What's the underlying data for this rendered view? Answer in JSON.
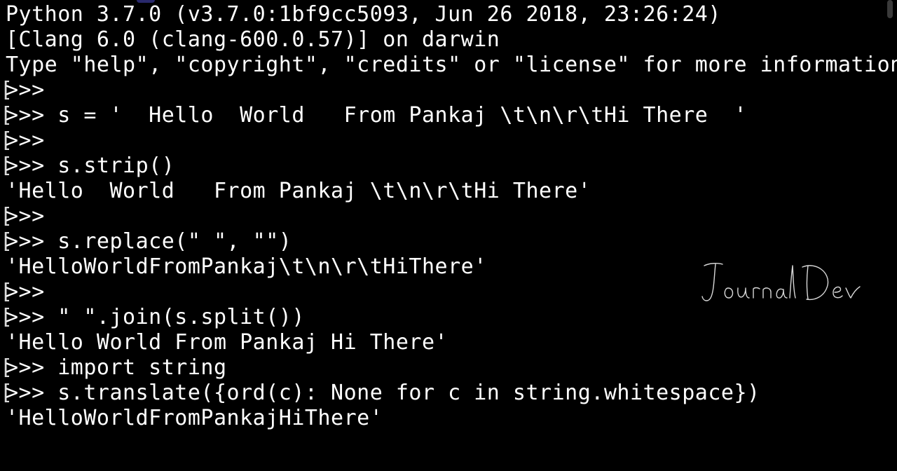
{
  "terminal": {
    "lines": [
      {
        "marker": false,
        "text": "Python 3.7.0 (v3.7.0:1bf9cc5093, Jun 26 2018, 23:26:24)"
      },
      {
        "marker": false,
        "text": "[Clang 6.0 (clang-600.0.57)] on darwin"
      },
      {
        "marker": false,
        "text": "Type \"help\", \"copyright\", \"credits\" or \"license\" for more information."
      },
      {
        "marker": true,
        "text": ">>>"
      },
      {
        "marker": true,
        "text": ">>> s = '  Hello  World   From Pankaj \\t\\n\\r\\tHi There  '"
      },
      {
        "marker": true,
        "text": ">>>"
      },
      {
        "marker": true,
        "text": ">>> s.strip()"
      },
      {
        "marker": false,
        "text": "'Hello  World   From Pankaj \\t\\n\\r\\tHi There'"
      },
      {
        "marker": true,
        "text": ">>>"
      },
      {
        "marker": true,
        "text": ">>> s.replace(\" \", \"\")"
      },
      {
        "marker": false,
        "text": "'HelloWorldFromPankaj\\t\\n\\r\\tHiThere'"
      },
      {
        "marker": true,
        "text": ">>>"
      },
      {
        "marker": true,
        "text": ">>> \" \".join(s.split())"
      },
      {
        "marker": false,
        "text": "'Hello World From Pankaj Hi There'"
      },
      {
        "marker": true,
        "text": ">>> import string"
      },
      {
        "marker": true,
        "text": ">>> s.translate({ord(c): None for c in string.whitespace})"
      },
      {
        "marker": false,
        "text": "'HelloWorldFromPankajHiThere'"
      }
    ],
    "marker_char": "[",
    "prompt": ">>>",
    "watermark": "JournalDev",
    "colors": {
      "background": "#000000",
      "foreground": "#ffffff",
      "cursor": "#a9a9a9"
    }
  }
}
